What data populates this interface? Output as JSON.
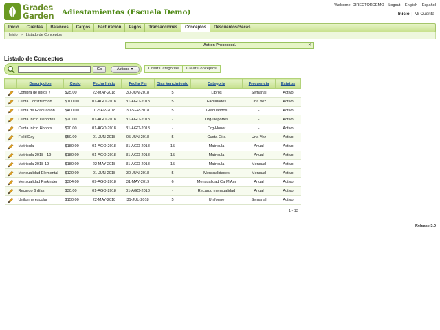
{
  "brand": {
    "logo_line1": "Grades",
    "logo_line2": "Garden",
    "app_title": "Adiestamientos (Escuela Demo)"
  },
  "top_links": {
    "welcome": "Welcome: DIRECTORDEMO",
    "logout": "Logout",
    "english": "English",
    "espanol": "Español"
  },
  "user_links": {
    "inicio": "Inicio",
    "separator": "|",
    "mi_cuenta": "Mi Cuenta"
  },
  "nav": {
    "tabs": [
      {
        "label": "Inicio",
        "active": false
      },
      {
        "label": "Cuentas",
        "active": false
      },
      {
        "label": "Balances",
        "active": false
      },
      {
        "label": "Cargos",
        "active": false
      },
      {
        "label": "Facturación",
        "active": false
      },
      {
        "label": "Pagos",
        "active": false
      },
      {
        "label": "Transacciones",
        "active": false
      },
      {
        "label": "Conceptos",
        "active": true
      },
      {
        "label": "Descuentos/Becas",
        "active": false
      }
    ]
  },
  "breadcrumb": {
    "home": "Inicio",
    "separator": ">",
    "current": "Listado de Conceptos"
  },
  "message": {
    "text": "Action Processed.",
    "close": "✕"
  },
  "page_title": "Listado de Conceptos",
  "search": {
    "value": "",
    "placeholder": "",
    "go_label": "Go",
    "actions_label": "Actions"
  },
  "buttons": {
    "crear_categorias": "Crear Categorias",
    "crear_conceptos": "Crear Conceptos"
  },
  "table": {
    "headers": [
      "Descripcion",
      "Costo",
      "Fecha Inicio",
      "Fecha Fin",
      "Dias Vencimiento",
      "Categoria",
      "Frecuencia",
      "Estatus"
    ],
    "rows": [
      [
        "Compra de libros 7",
        "$25.00",
        "22-MAY-2018",
        "30-JUN-2018",
        "5",
        "Libros",
        "Semanal",
        "Activo"
      ],
      [
        "Cuota Construcción",
        "$100.00",
        "01-AGO-2018",
        "31-AGO-2018",
        "5",
        "Facilidades",
        "Una Vez",
        "Activo"
      ],
      [
        "Cuota de Graduación",
        "$400.00",
        "01-SEP-2018",
        "30-SEP-2018",
        "5",
        "Graduandos",
        "-",
        "Activo"
      ],
      [
        "Cuota Inicio Deportes",
        "$20.00",
        "01-AGO-2018",
        "31-AGO-2018",
        "-",
        "Org-Deportes",
        "-",
        "Activo"
      ],
      [
        "Cuota Inicio Honors",
        "$20.00",
        "01-AGO-2018",
        "31-AGO-2018",
        "-",
        "Org-Honor",
        "-",
        "Activo"
      ],
      [
        "Field Day",
        "$50.00",
        "01-JUN-2018",
        "05-JUN-2018",
        "5",
        "Cuota Gira",
        "Una Vez",
        "Activo"
      ],
      [
        "Matricula",
        "$180.00",
        "01-AGO-2018",
        "31-AGO-2018",
        "15",
        "Matricula",
        "Anual",
        "Activo"
      ],
      [
        "Matricula 2018 - 19",
        "$180.00",
        "01-AGO-2018",
        "31-AGO-2018",
        "15",
        "Matricula",
        "Anual",
        "Activo"
      ],
      [
        "Matricula 2018-19",
        "$180.00",
        "22-MAY-2018",
        "31-AGO-2018",
        "15",
        "Matricula",
        "Mensual",
        "Activo"
      ],
      [
        "Mensualidad Elemental",
        "$120.00",
        "01-JUN-2018",
        "30-JUN-2018",
        "5",
        "Mensualidades",
        "Mensual",
        "Activo"
      ],
      [
        "Mensualidad Prekinder",
        "$304.00",
        "09-AGO-2018",
        "31-MAY-2019",
        "6",
        "Mensualidad CarMiAm",
        "Anual",
        "Activo"
      ],
      [
        "Recargo 6 días",
        "$30.00",
        "01-AGO-2018",
        "01-AGO-2018",
        "-",
        "Recargo mensualidad",
        "Anual",
        "Activo"
      ],
      [
        "Uniforme escolar",
        "$150.00",
        "22-MAY-2018",
        "31-JUL-2018",
        "5",
        "Uniforme",
        "Semanal",
        "Activo"
      ]
    ]
  },
  "pager": "1 - 13",
  "release": "Release 3.0",
  "colors": {
    "accent_green": "#4f8a16",
    "nav_green": "#c8e18e",
    "header_link_blue": "#1a4f94",
    "pencil_orange": "#e0a020"
  }
}
